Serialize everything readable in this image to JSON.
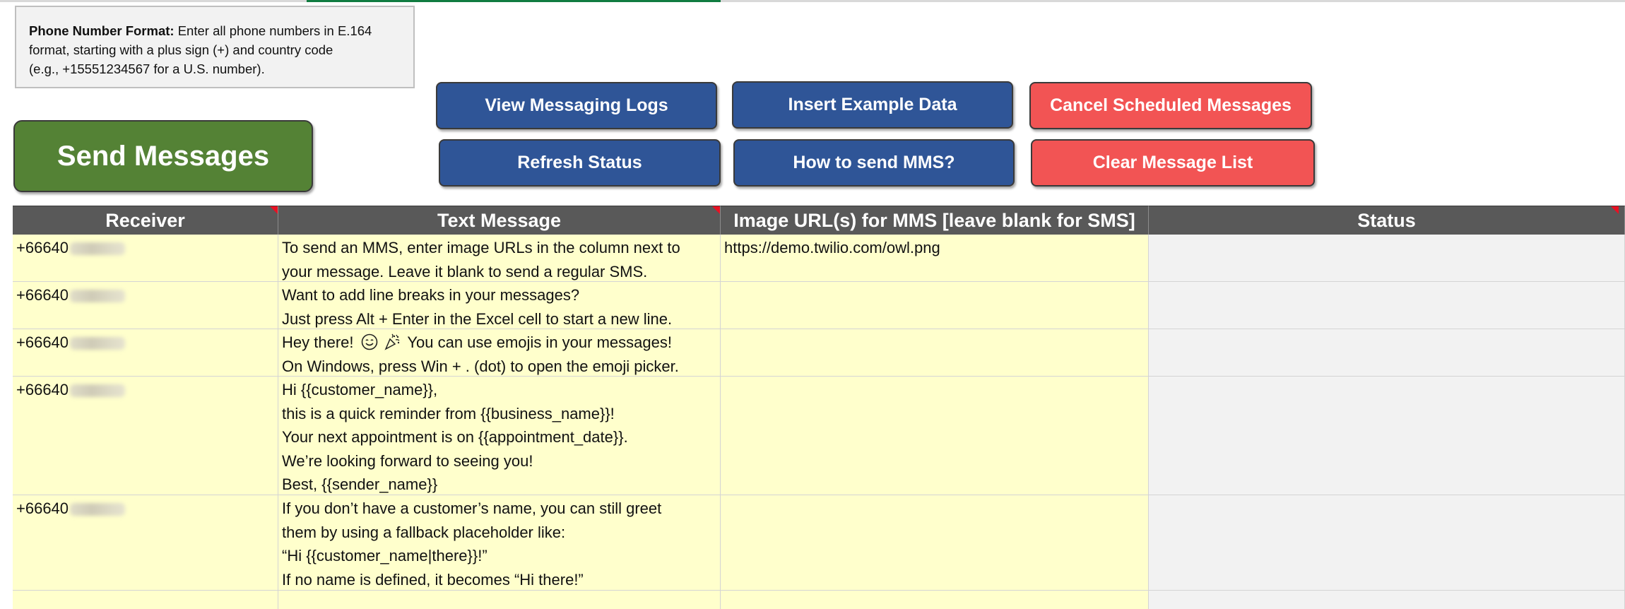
{
  "note": {
    "label": "Phone Number Format:",
    "text_1": " Enter all phone numbers in E.164",
    "text_2": "format, starting with a plus sign (+) and country code",
    "text_3": "(e.g., +15551234567 for a U.S. number)."
  },
  "buttons": {
    "send": "Send Messages",
    "view_logs": "View Messaging Logs",
    "insert_example": "Insert Example Data",
    "cancel_scheduled": "Cancel Scheduled Messages",
    "refresh": "Refresh Status",
    "how_mms": "How to send MMS?",
    "clear_list": "Clear Message List"
  },
  "table": {
    "headers": {
      "receiver": "Receiver",
      "text": "Text Message",
      "image": "Image URL(s) for MMS [leave blank for SMS]",
      "status": "Status"
    },
    "rows": [
      {
        "receiver": "+66640",
        "lines": [
          "To send an MMS, enter image URLs in the column next to",
          "your message. Leave it blank to send a regular SMS."
        ],
        "image": "https://demo.twilio.com/owl.png",
        "status": ""
      },
      {
        "receiver": "+66640",
        "lines": [
          "Want to add line breaks in your messages?",
          "Just press Alt + Enter in the Excel cell to start a new line."
        ],
        "image": "",
        "status": ""
      },
      {
        "receiver": "+66640",
        "line_a_start": "Hey there!",
        "line_a_end": "You can use emojis in your messages!",
        "line_b": "On Windows, press Win + . (dot) to open the emoji picker.",
        "image": "",
        "status": ""
      },
      {
        "receiver": "+66640",
        "lines": [
          "Hi {{customer_name}},",
          "this is a quick reminder from {{business_name}}!",
          "Your next appointment is on {{appointment_date}}.",
          "We’re looking forward to seeing you!",
          "Best, {{sender_name}}"
        ],
        "image": "",
        "status": ""
      },
      {
        "receiver": "+66640",
        "lines": [
          "If you don’t have a customer’s name, you can still greet",
          "them by using a fallback placeholder like:",
          "“Hi {{customer_name|there}}!”",
          "If no name is defined, it becomes “Hi there!”"
        ],
        "image": "",
        "status": ""
      }
    ]
  },
  "colors": {
    "header_bg": "#595959",
    "input_cell_bg": "#ffffcc",
    "status_cell_bg": "#f2f2f2",
    "blue_button": "#2f5597",
    "red_button": "#f25454",
    "green_button": "#548235",
    "comment_marker": "#e81123"
  },
  "icons": {
    "smile": "smiling-face-icon",
    "party": "party-popper-icon"
  }
}
